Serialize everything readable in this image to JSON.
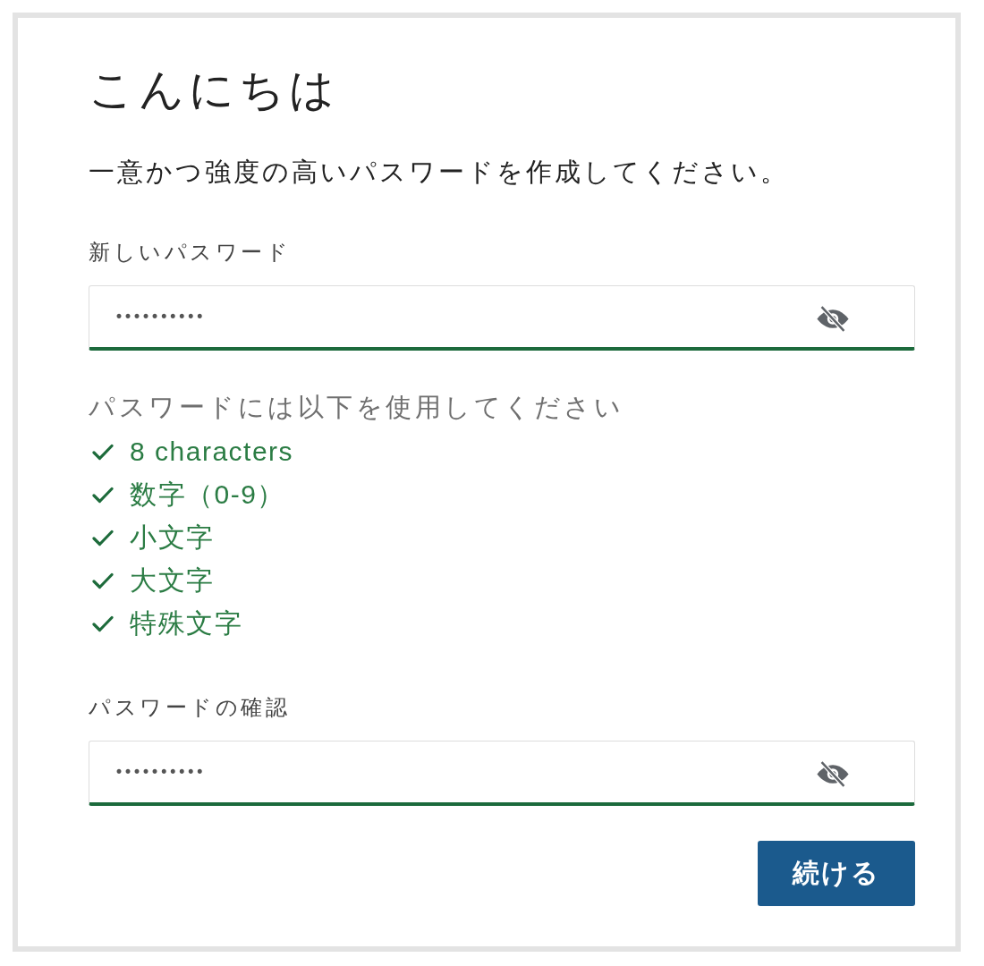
{
  "heading": "こんにちは",
  "instruction": "一意かつ強度の高いパスワードを作成してください。",
  "new_password": {
    "label": "新しいパスワード",
    "value": "••••••••••",
    "valid": true
  },
  "requirements": {
    "title": "パスワードには以下を使用してください",
    "items": [
      {
        "label": "8 characters",
        "met": true
      },
      {
        "label": "数字（0-9）",
        "met": true
      },
      {
        "label": "小文字",
        "met": true
      },
      {
        "label": "大文字",
        "met": true
      },
      {
        "label": "特殊文字",
        "met": true
      }
    ]
  },
  "confirm_password": {
    "label": "パスワードの確認",
    "value": "••••••••••",
    "valid": true
  },
  "continue_button": {
    "label": "続ける"
  }
}
